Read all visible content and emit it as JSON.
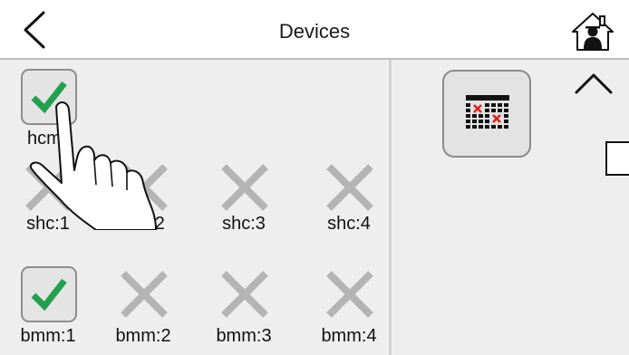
{
  "header": {
    "title": "Devices",
    "back_icon": "chevron-left-icon",
    "home_icon": "home-user-icon"
  },
  "devices": [
    {
      "label": "hcm",
      "state": "checked"
    },
    {
      "label": "shc:1",
      "state": "unavailable"
    },
    {
      "label": "shc:2",
      "state": "unavailable"
    },
    {
      "label": "shc:3",
      "state": "unavailable"
    },
    {
      "label": "shc:4",
      "state": "unavailable"
    },
    {
      "label": "bmm:1",
      "state": "checked"
    },
    {
      "label": "bmm:2",
      "state": "unavailable"
    },
    {
      "label": "bmm:3",
      "state": "unavailable"
    },
    {
      "label": "bmm:4",
      "state": "unavailable"
    }
  ],
  "side_panel": {
    "schedule_icon": "calendar-cross-icon",
    "scroll_up_icon": "chevron-up-icon"
  },
  "overlay": {
    "icon": "pointing-hand-icon"
  },
  "colors": {
    "check": "#22a04b",
    "cross": "#b4b4b4",
    "calendar_cross": "#e41f1f"
  }
}
